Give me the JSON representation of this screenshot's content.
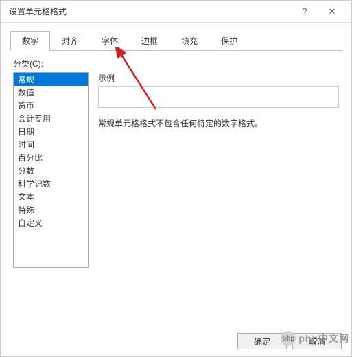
{
  "titlebar": {
    "title": "设置单元格格式",
    "help": "?",
    "close": "✕"
  },
  "tabs": [
    "数字",
    "对齐",
    "字体",
    "边框",
    "填充",
    "保护"
  ],
  "active_tab_index": 0,
  "category_label": "分类(C):",
  "categories": [
    "常规",
    "数值",
    "货币",
    "会计专用",
    "日期",
    "时间",
    "百分比",
    "分数",
    "科学记数",
    "文本",
    "特殊",
    "自定义"
  ],
  "selected_category_index": 0,
  "example_label": "示例",
  "description": "常规单元格格式不包含任何特定的数字格式。",
  "buttons": {
    "ok": "确定",
    "cancel": "取消"
  },
  "watermark": {
    "icon_text": "php",
    "text": "php中文网"
  }
}
